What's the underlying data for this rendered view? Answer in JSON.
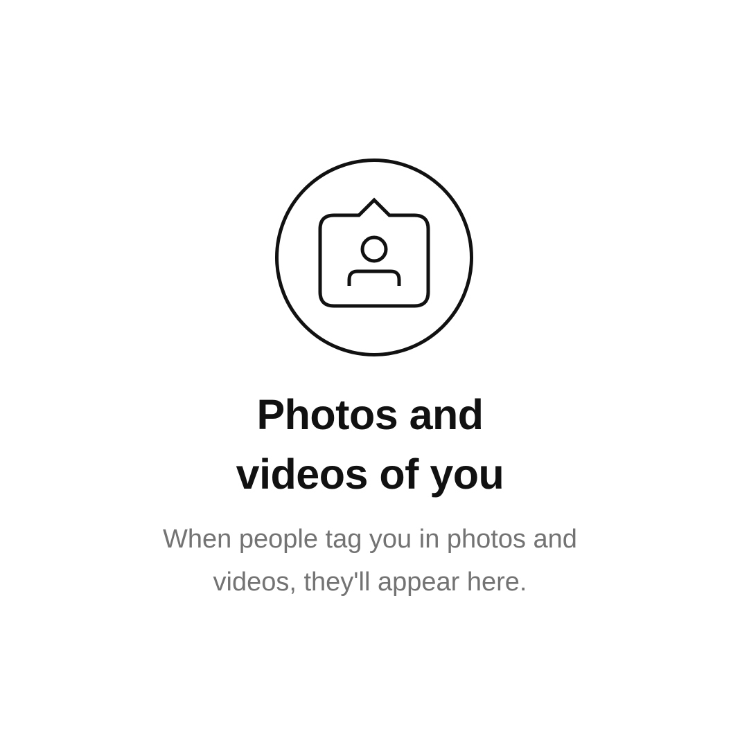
{
  "empty_state": {
    "icon": "tagged-photo-icon",
    "title_lines": [
      "Photos and",
      "videos of you"
    ],
    "subtitle_lines": [
      "When people tag you in photos and",
      "videos, they'll appear here."
    ]
  },
  "colors": {
    "background": "#ffffff",
    "title": "#111111",
    "subtitle": "#737373",
    "icon_stroke": "#111111"
  }
}
